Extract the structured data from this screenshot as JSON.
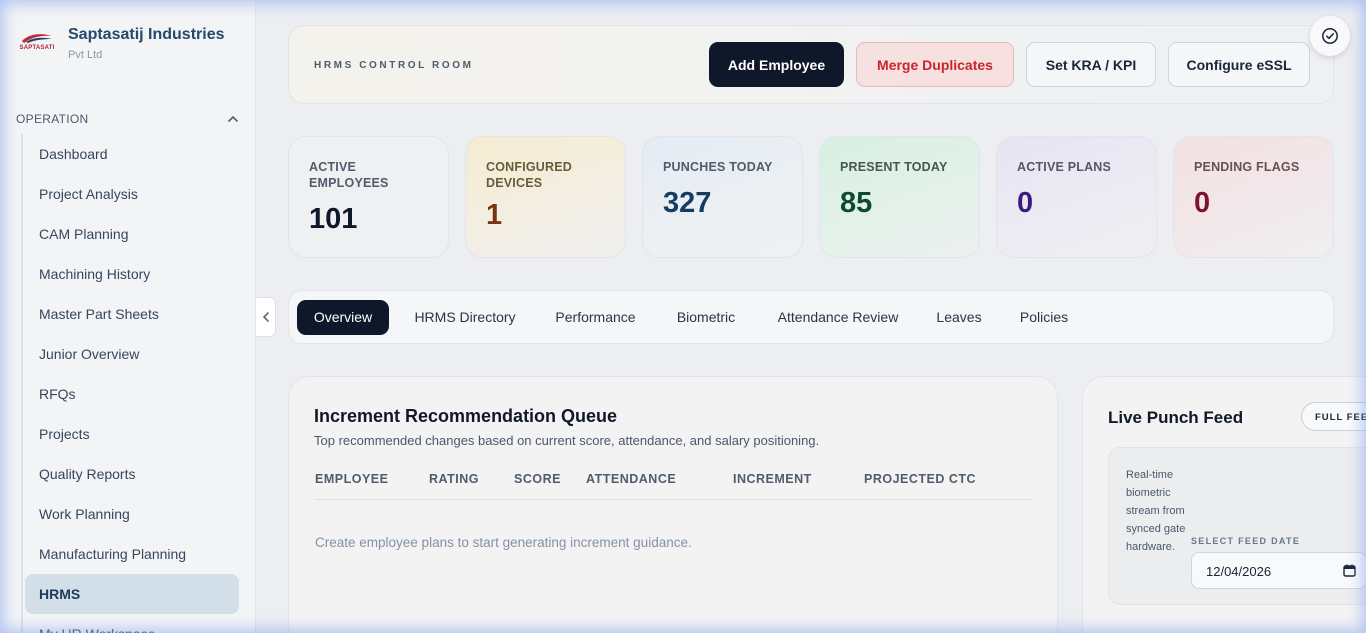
{
  "brand": {
    "logo_text": "SAPTASATI",
    "name": "Saptasatij Industries",
    "sub": "Pvt Ltd"
  },
  "sidebar": {
    "section": "OPERATION",
    "items": [
      {
        "label": "Dashboard"
      },
      {
        "label": "Project Analysis"
      },
      {
        "label": "CAM Planning"
      },
      {
        "label": "Machining History"
      },
      {
        "label": "Master Part Sheets"
      },
      {
        "label": "Junior Overview"
      },
      {
        "label": "RFQs"
      },
      {
        "label": "Projects"
      },
      {
        "label": "Quality Reports"
      },
      {
        "label": "Work Planning"
      },
      {
        "label": "Manufacturing Planning"
      },
      {
        "label": "HRMS"
      },
      {
        "label": "My HR Workspace"
      }
    ],
    "active": "HRMS"
  },
  "header": {
    "title": "HRMS CONTROL ROOM",
    "buttons": {
      "add": "Add Employee",
      "merge": "Merge Duplicates",
      "kra": "Set KRA / KPI",
      "essl": "Configure eSSL"
    }
  },
  "stats": [
    {
      "label": "ACTIVE EMPLOYEES",
      "value": "101"
    },
    {
      "label": "CONFIGURED DEVICES",
      "value": "1"
    },
    {
      "label": "PUNCHES TODAY",
      "value": "327"
    },
    {
      "label": "PRESENT TODAY",
      "value": "85"
    },
    {
      "label": "ACTIVE PLANS",
      "value": "0"
    },
    {
      "label": "PENDING FLAGS",
      "value": "0"
    }
  ],
  "tabs": [
    {
      "label": "Overview"
    },
    {
      "label": "HRMS Directory"
    },
    {
      "label": "Performance"
    },
    {
      "label": "Biometric"
    },
    {
      "label": "Attendance Review"
    },
    {
      "label": "Leaves"
    },
    {
      "label": "Policies"
    }
  ],
  "active_tab": "Overview",
  "increment": {
    "title": "Increment Recommendation Queue",
    "subtitle": "Top recommended changes based on current score, attendance, and salary positioning.",
    "columns": [
      "EMPLOYEE",
      "RATING",
      "SCORE",
      "ATTENDANCE",
      "INCREMENT",
      "PROJECTED CTC"
    ],
    "empty": "Create employee plans to start generating increment guidance."
  },
  "feed": {
    "title": "Live Punch Feed",
    "button": "FULL FEED",
    "description": "Real-time biometric stream from synced gate hardware.",
    "date_label": "SELECT FEED DATE",
    "date_value": "12/04/2026"
  },
  "colors": {
    "dark": "#0f172a",
    "danger": "#c9252b",
    "accent": "#244a6b"
  }
}
